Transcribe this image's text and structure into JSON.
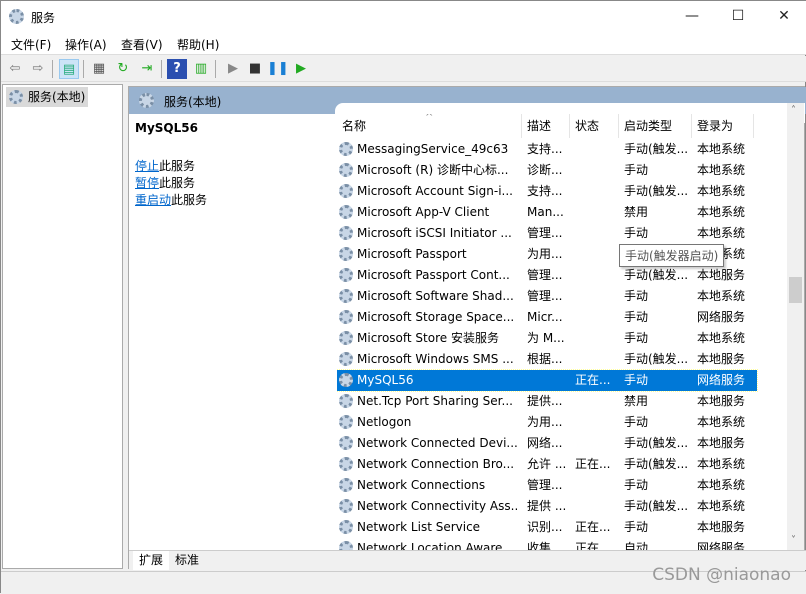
{
  "window": {
    "title": "服务",
    "minimize": "—",
    "maximize": "☐",
    "close": "✕"
  },
  "menu": [
    "文件(F)",
    "操作(A)",
    "查看(V)",
    "帮助(H)"
  ],
  "toolbar": {
    "icons": [
      "back-icon",
      "forward-icon",
      "show-hide-tree-icon",
      "properties-icon",
      "refresh-icon",
      "export-list-icon",
      "help-icon",
      "show-action-pane-icon",
      "start-icon",
      "stop-icon",
      "pause-icon",
      "resume-icon"
    ]
  },
  "tree": {
    "item": "服务(本地)"
  },
  "pane": {
    "title": "服务(本地)"
  },
  "details": {
    "name": "MySQL56",
    "actions": [
      {
        "link": "停止",
        "rest": "此服务"
      },
      {
        "link": "暂停",
        "rest": "此服务"
      },
      {
        "link": "重启动",
        "rest": "此服务"
      }
    ]
  },
  "columns": [
    "名称",
    "描述",
    "状态",
    "启动类型",
    "登录为"
  ],
  "rows": [
    [
      "MessagingService_49c63",
      "支持...",
      "",
      "手动(触发...",
      "本地系统"
    ],
    [
      "Microsoft (R) 诊断中心标...",
      "诊断...",
      "",
      "手动",
      "本地系统"
    ],
    [
      "Microsoft Account Sign-i...",
      "支持...",
      "",
      "手动(触发...",
      "本地系统"
    ],
    [
      "Microsoft App-V Client",
      "Man...",
      "",
      "禁用",
      "本地系统"
    ],
    [
      "Microsoft iSCSI Initiator ...",
      "管理...",
      "",
      "手动",
      "本地系统"
    ],
    [
      "Microsoft Passport",
      "为用...",
      "",
      "手动(触发...",
      "本地系统"
    ],
    [
      "Microsoft Passport Cont...",
      "管理...",
      "",
      "手动(触发...",
      "本地服务"
    ],
    [
      "Microsoft Software Shad...",
      "管理...",
      "",
      "手动",
      "本地系统"
    ],
    [
      "Microsoft Storage Space...",
      "Micr...",
      "",
      "手动",
      "网络服务"
    ],
    [
      "Microsoft Store 安装服务",
      "为 M...",
      "",
      "手动",
      "本地系统"
    ],
    [
      "Microsoft Windows SMS ...",
      "根据...",
      "",
      "手动(触发...",
      "本地服务"
    ],
    [
      "MySQL56",
      "",
      "正在...",
      "手动",
      "网络服务"
    ],
    [
      "Net.Tcp Port Sharing Ser...",
      "提供...",
      "",
      "禁用",
      "本地服务"
    ],
    [
      "Netlogon",
      "为用...",
      "",
      "手动",
      "本地系统"
    ],
    [
      "Network Connected Devi...",
      "网络...",
      "",
      "手动(触发...",
      "本地服务"
    ],
    [
      "Network Connection Bro...",
      "允许 ...",
      "正在...",
      "手动(触发...",
      "本地系统"
    ],
    [
      "Network Connections",
      "管理...",
      "",
      "手动",
      "本地系统"
    ],
    [
      "Network Connectivity Ass...",
      "提供 ...",
      "",
      "手动(触发...",
      "本地系统"
    ],
    [
      "Network List Service",
      "识别...",
      "正在...",
      "手动",
      "本地服务"
    ],
    [
      "Network Location Aware...",
      "收集...",
      "正在...",
      "自动",
      "网络服务"
    ]
  ],
  "selected_row": "MySQL56",
  "tooltip": "手动(触发器启动)",
  "tabs": [
    "扩展",
    "标准"
  ],
  "watermark": "CSDN @niaonao",
  "colors": {
    "selection": "#0078d7",
    "link": "#0066cc",
    "band": "#98b2cf"
  }
}
